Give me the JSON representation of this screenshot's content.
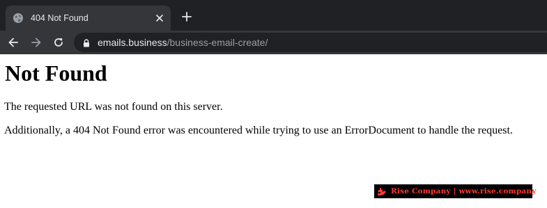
{
  "browser": {
    "tab": {
      "title": "404 Not Found",
      "favicon": "globe-icon"
    },
    "new_tab_icon": "plus-icon",
    "nav": {
      "back_icon": "arrow-left-icon",
      "forward_icon": "arrow-right-icon",
      "reload_icon": "reload-icon"
    },
    "address_bar": {
      "security_icon": "lock-icon",
      "host": "emails.business",
      "path": "/business-email-create/"
    }
  },
  "page": {
    "heading": "Not Found",
    "message": "The requested URL was not found on this server.",
    "detail": "Additionally, a 404 Not Found error was encountered while trying to use an ErrorDocument to handle the request."
  },
  "watermark": {
    "text": "Rise Company | www.rise.company",
    "logo": "rise-company-logo",
    "color": "#ff3b30"
  },
  "colors": {
    "tabstrip": "#202124",
    "toolbar": "#35363a",
    "omnibox": "#202124",
    "url_host": "#e8eaed",
    "url_path": "#9aa0a6"
  }
}
